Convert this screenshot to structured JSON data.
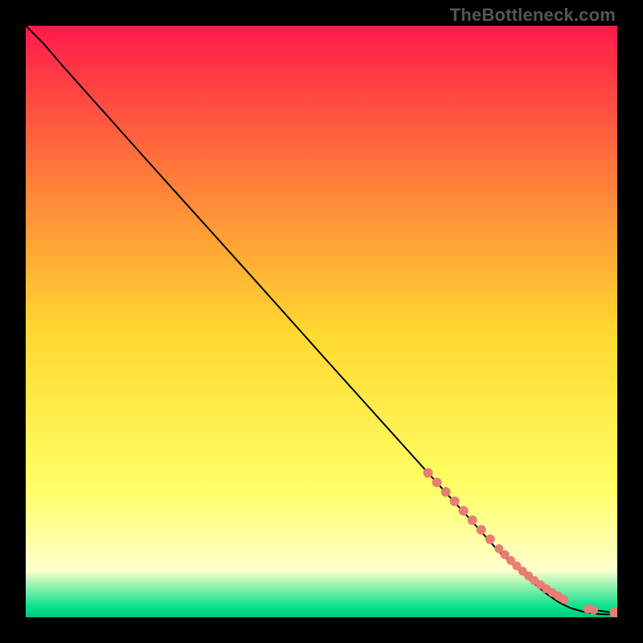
{
  "watermark": "TheBottleneck.com",
  "colors": {
    "black": "#000000",
    "curve": "#000000",
    "dot": "#e87e73",
    "grad_top": "#ff1a4b",
    "grad_mid_upper": "#ff7a3a",
    "grad_mid": "#ffd92f",
    "grad_mid_lower": "#ffff66",
    "grad_pale": "#ffffcc",
    "grad_green": "#00e08a"
  },
  "chart_data": {
    "type": "line",
    "title": "",
    "xlabel": "",
    "ylabel": "",
    "xlim": [
      0,
      100
    ],
    "ylim": [
      0,
      100
    ],
    "series": [
      {
        "name": "curve",
        "x": [
          0,
          3,
          6,
          10,
          20,
          30,
          40,
          50,
          60,
          70,
          75,
          80,
          85,
          88,
          90,
          92,
          94,
          95,
          96,
          97,
          98,
          100
        ],
        "y": [
          100,
          97,
          93.5,
          89,
          77.8,
          66.7,
          55.6,
          44.4,
          33.3,
          22.2,
          16.7,
          11.1,
          6.5,
          4.0,
          2.6,
          1.6,
          1.0,
          0.8,
          0.65,
          0.55,
          0.5,
          0.5
        ]
      }
    ],
    "dots": {
      "name": "highlight-points",
      "x": [
        68,
        69.5,
        71,
        72.5,
        74,
        75.5,
        77,
        78.5,
        80,
        81,
        82,
        83,
        84,
        85,
        86,
        87,
        88,
        89,
        90,
        91,
        95,
        96,
        99.5,
        100
      ],
      "y": [
        24.4,
        22.8,
        21.2,
        19.6,
        18.0,
        16.4,
        14.8,
        13.2,
        11.6,
        10.6,
        9.6,
        8.7,
        7.8,
        7.0,
        6.2,
        5.5,
        4.8,
        4.2,
        3.6,
        3.0,
        1.4,
        1.2,
        0.8,
        0.8
      ],
      "r": [
        6,
        6,
        6,
        6,
        6,
        6,
        6,
        6,
        5.5,
        5.5,
        5.5,
        5.5,
        5.5,
        5.5,
        5.5,
        5.5,
        5.5,
        5.5,
        5.5,
        5.5,
        5.5,
        5.5,
        6,
        6
      ]
    }
  }
}
